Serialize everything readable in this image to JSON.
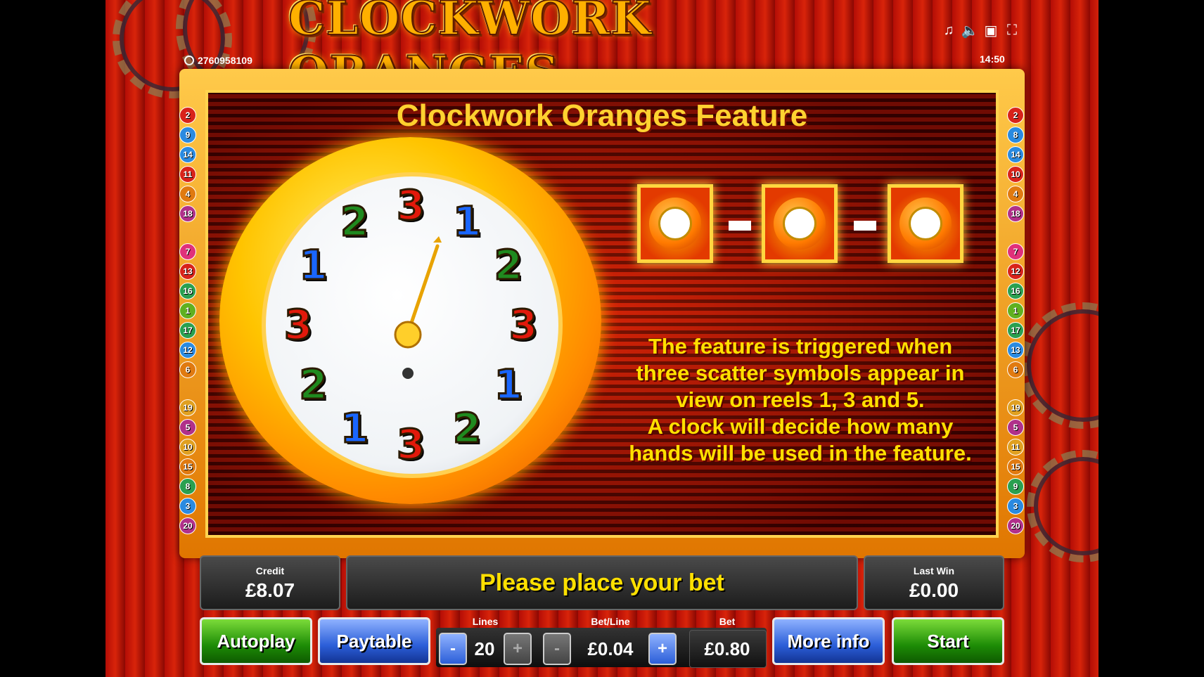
{
  "header": {
    "logo_text": "CLOCKWORK ORANGES",
    "ticket_id": "2760958109",
    "time": "14:50",
    "icons": [
      "music-icon",
      "speaker-icon",
      "window-icon",
      "fullscreen-icon"
    ]
  },
  "feature": {
    "title": "Clockwork Oranges Feature",
    "description_lines": [
      "The feature is triggered when",
      "three scatter symbols appear in",
      "view on reels 1, 3 and 5.",
      "A clock will decide how many",
      "hands will be used in the feature."
    ],
    "clock_numbers": [
      "3",
      "1",
      "2",
      "3",
      "1",
      "2",
      "3",
      "1",
      "2",
      "3",
      "1",
      "2"
    ]
  },
  "line_markers": {
    "left": [
      "2",
      "9",
      "14",
      "11",
      "4",
      "18",
      "7",
      "13",
      "16",
      "1",
      "17",
      "12",
      "6",
      "19",
      "5",
      "10",
      "15",
      "8",
      "3",
      "20"
    ],
    "right": [
      "2",
      "8",
      "14",
      "10",
      "4",
      "18",
      "7",
      "12",
      "16",
      "1",
      "17",
      "13",
      "6",
      "19",
      "5",
      "11",
      "15",
      "9",
      "3",
      "20"
    ]
  },
  "status": {
    "credit_label": "Credit",
    "credit_value": "£8.07",
    "message": "Please place your bet",
    "last_win_label": "Last Win",
    "last_win_value": "£0.00"
  },
  "controls": {
    "autoplay": "Autoplay",
    "paytable": "Paytable",
    "lines_label": "Lines",
    "lines_value": "20",
    "betline_label": "Bet/Line",
    "betline_value": "£0.04",
    "bet_label": "Bet",
    "bet_value": "£0.80",
    "more_info": "More info",
    "start": "Start",
    "minus": "-",
    "plus": "+"
  }
}
